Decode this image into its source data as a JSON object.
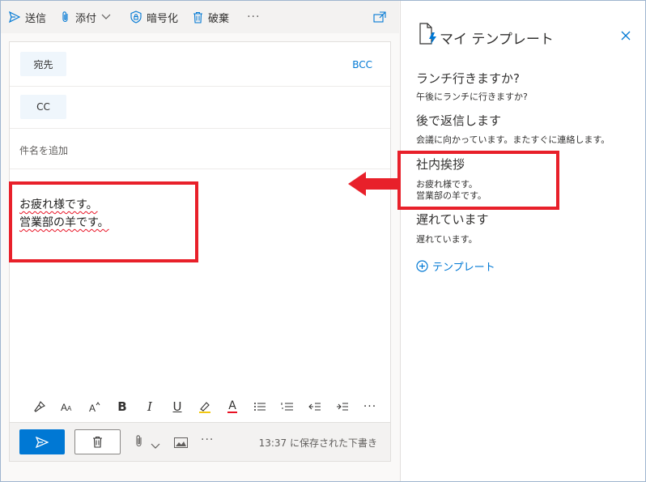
{
  "toolbar": {
    "send": "送信",
    "attach": "添付",
    "encrypt": "暗号化",
    "discard": "破棄",
    "more": "···"
  },
  "compose": {
    "to_label": "宛先",
    "bcc_label": "BCC",
    "cc_label": "CC",
    "subject_placeholder": "件名を追加",
    "body_lines": [
      "お疲れ様です。",
      "営業部の羊です。"
    ]
  },
  "format_bar": {
    "bold": "B",
    "italic": "I",
    "underline": "U",
    "font_color": "A",
    "more": "···"
  },
  "action_bar": {
    "more": "···",
    "saved_status": "13:37 に保存された下書き"
  },
  "template_panel": {
    "title": "マイ テンプレート",
    "templates": [
      {
        "title": "ランチ行きますか?",
        "body_lines": [
          "午後にランチに行きますか?"
        ]
      },
      {
        "title": "後で返信します",
        "body_lines": [
          "会議に向かっています。またすぐに連絡します。"
        ]
      },
      {
        "title": "社内挨拶",
        "body_lines": [
          "お疲れ様です。",
          "営業部の羊です。"
        ]
      },
      {
        "title": "遅れています",
        "body_lines": [
          "遅れています。"
        ]
      }
    ],
    "add_template_label": "テンプレート"
  },
  "colors": {
    "accent": "#0078d4",
    "annotation_red": "#e8202a",
    "toolbar_bg": "#f3f2f1"
  }
}
